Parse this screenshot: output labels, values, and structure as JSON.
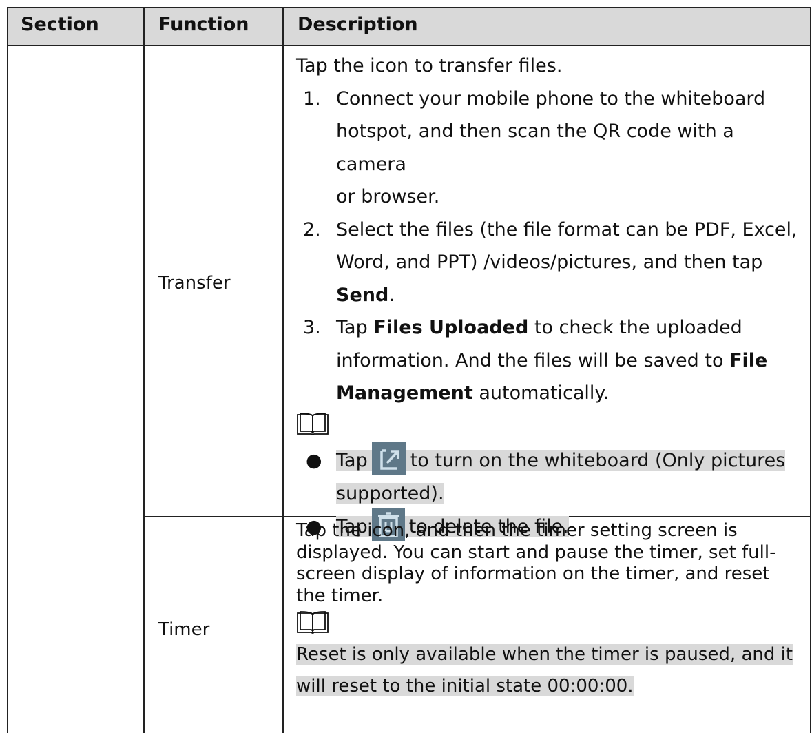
{
  "header": {
    "section": "Section",
    "function": "Function",
    "description": "Description"
  },
  "rows": [
    {
      "function": "Transfer",
      "intro": "Tap the icon to transfer files.",
      "steps": [
        {
          "num": "1.",
          "line1": "Connect your mobile phone to the whiteboard",
          "line2": "hotspot, and then scan the QR code with a camera",
          "line3": "or browser."
        },
        {
          "num": "2.",
          "line1": "Select the files (the file format can be PDF, Excel,",
          "line2": "Word, and PPT) /videos/pictures, and then tap",
          "bold": "Send",
          "after": "."
        },
        {
          "num": "3.",
          "pre": "Tap ",
          "bold1": "Files Uploaded",
          "post1": " to check the uploaded",
          "line2pre": "information. And the files will be saved to ",
          "bold2": "File",
          "bold3": "Management",
          "post3": " automatically."
        }
      ],
      "notes": [
        {
          "pre": "Tap",
          "icon": "fullscreen-arrow-icon",
          "post": "to turn on the whiteboard (Only pictures",
          "post2": "supported)."
        },
        {
          "pre": "Tap",
          "icon": "trash-icon",
          "post": "to delete the file."
        }
      ]
    },
    {
      "function": "Timer",
      "lines": [
        "Tap the icon, and then the timer setting screen is",
        "displayed. You can start and pause the timer, set full-",
        "screen display of information on the timer, and reset",
        "the timer."
      ],
      "note_line1": "Reset is only available when the timer is paused, and it",
      "note_line2": "will reset to the initial state 00:00:00."
    }
  ],
  "colors": {
    "header_bg": "#d9d9d9",
    "highlight": "#d9d9d9",
    "icon_bg": "#5f7888"
  }
}
